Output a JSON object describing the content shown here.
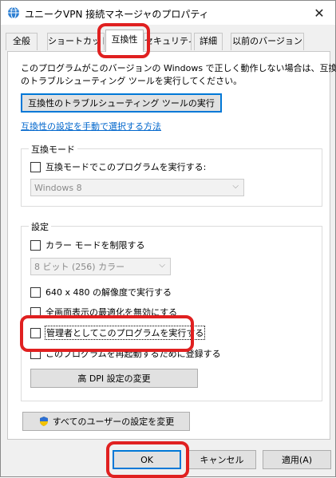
{
  "window": {
    "title": "ユニークVPN 接続マネージャのプロパティ"
  },
  "tabs": [
    {
      "label": "全般"
    },
    {
      "label": "ショートカット"
    },
    {
      "label": "互換性"
    },
    {
      "label": "セキュリティ"
    },
    {
      "label": "詳細"
    },
    {
      "label": "以前のバージョン"
    }
  ],
  "compat": {
    "description_line1": "このプログラムがこのバージョンの Windows で正しく動作しない場合は、互換性",
    "description_line2": "のトラブルシューティング ツールを実行してください。",
    "troubleshoot_button": "互換性のトラブルシューティング ツールの実行",
    "manual_link": "互換性の設定を手動で選択する方法",
    "mode_group_title": "互換モード",
    "mode_checkbox": "互換モードでこのプログラムを実行する:",
    "os_select_value": "Windows 8"
  },
  "settings": {
    "group_title": "設定",
    "reduced_color": "カラー モードを制限する",
    "color_select_value": "8 ビット (256) カラー",
    "resolution_640": "640 x 480 の解像度で実行する",
    "fullscreen_opt": "全画面表示の最適化を無効にする",
    "run_as_admin": "管理者としてこのプログラムを実行する",
    "register_restart": "このプログラムを再起動するために登録する",
    "dpi_button": "高 DPI 設定の変更"
  },
  "all_users_button": "すべてのユーザーの設定を変更",
  "footer": {
    "ok": "OK",
    "cancel": "キャンセル",
    "apply": "適用(A)"
  },
  "colors": {
    "highlight": "#e02020",
    "link": "#0066cc",
    "focus": "#0078d7"
  }
}
